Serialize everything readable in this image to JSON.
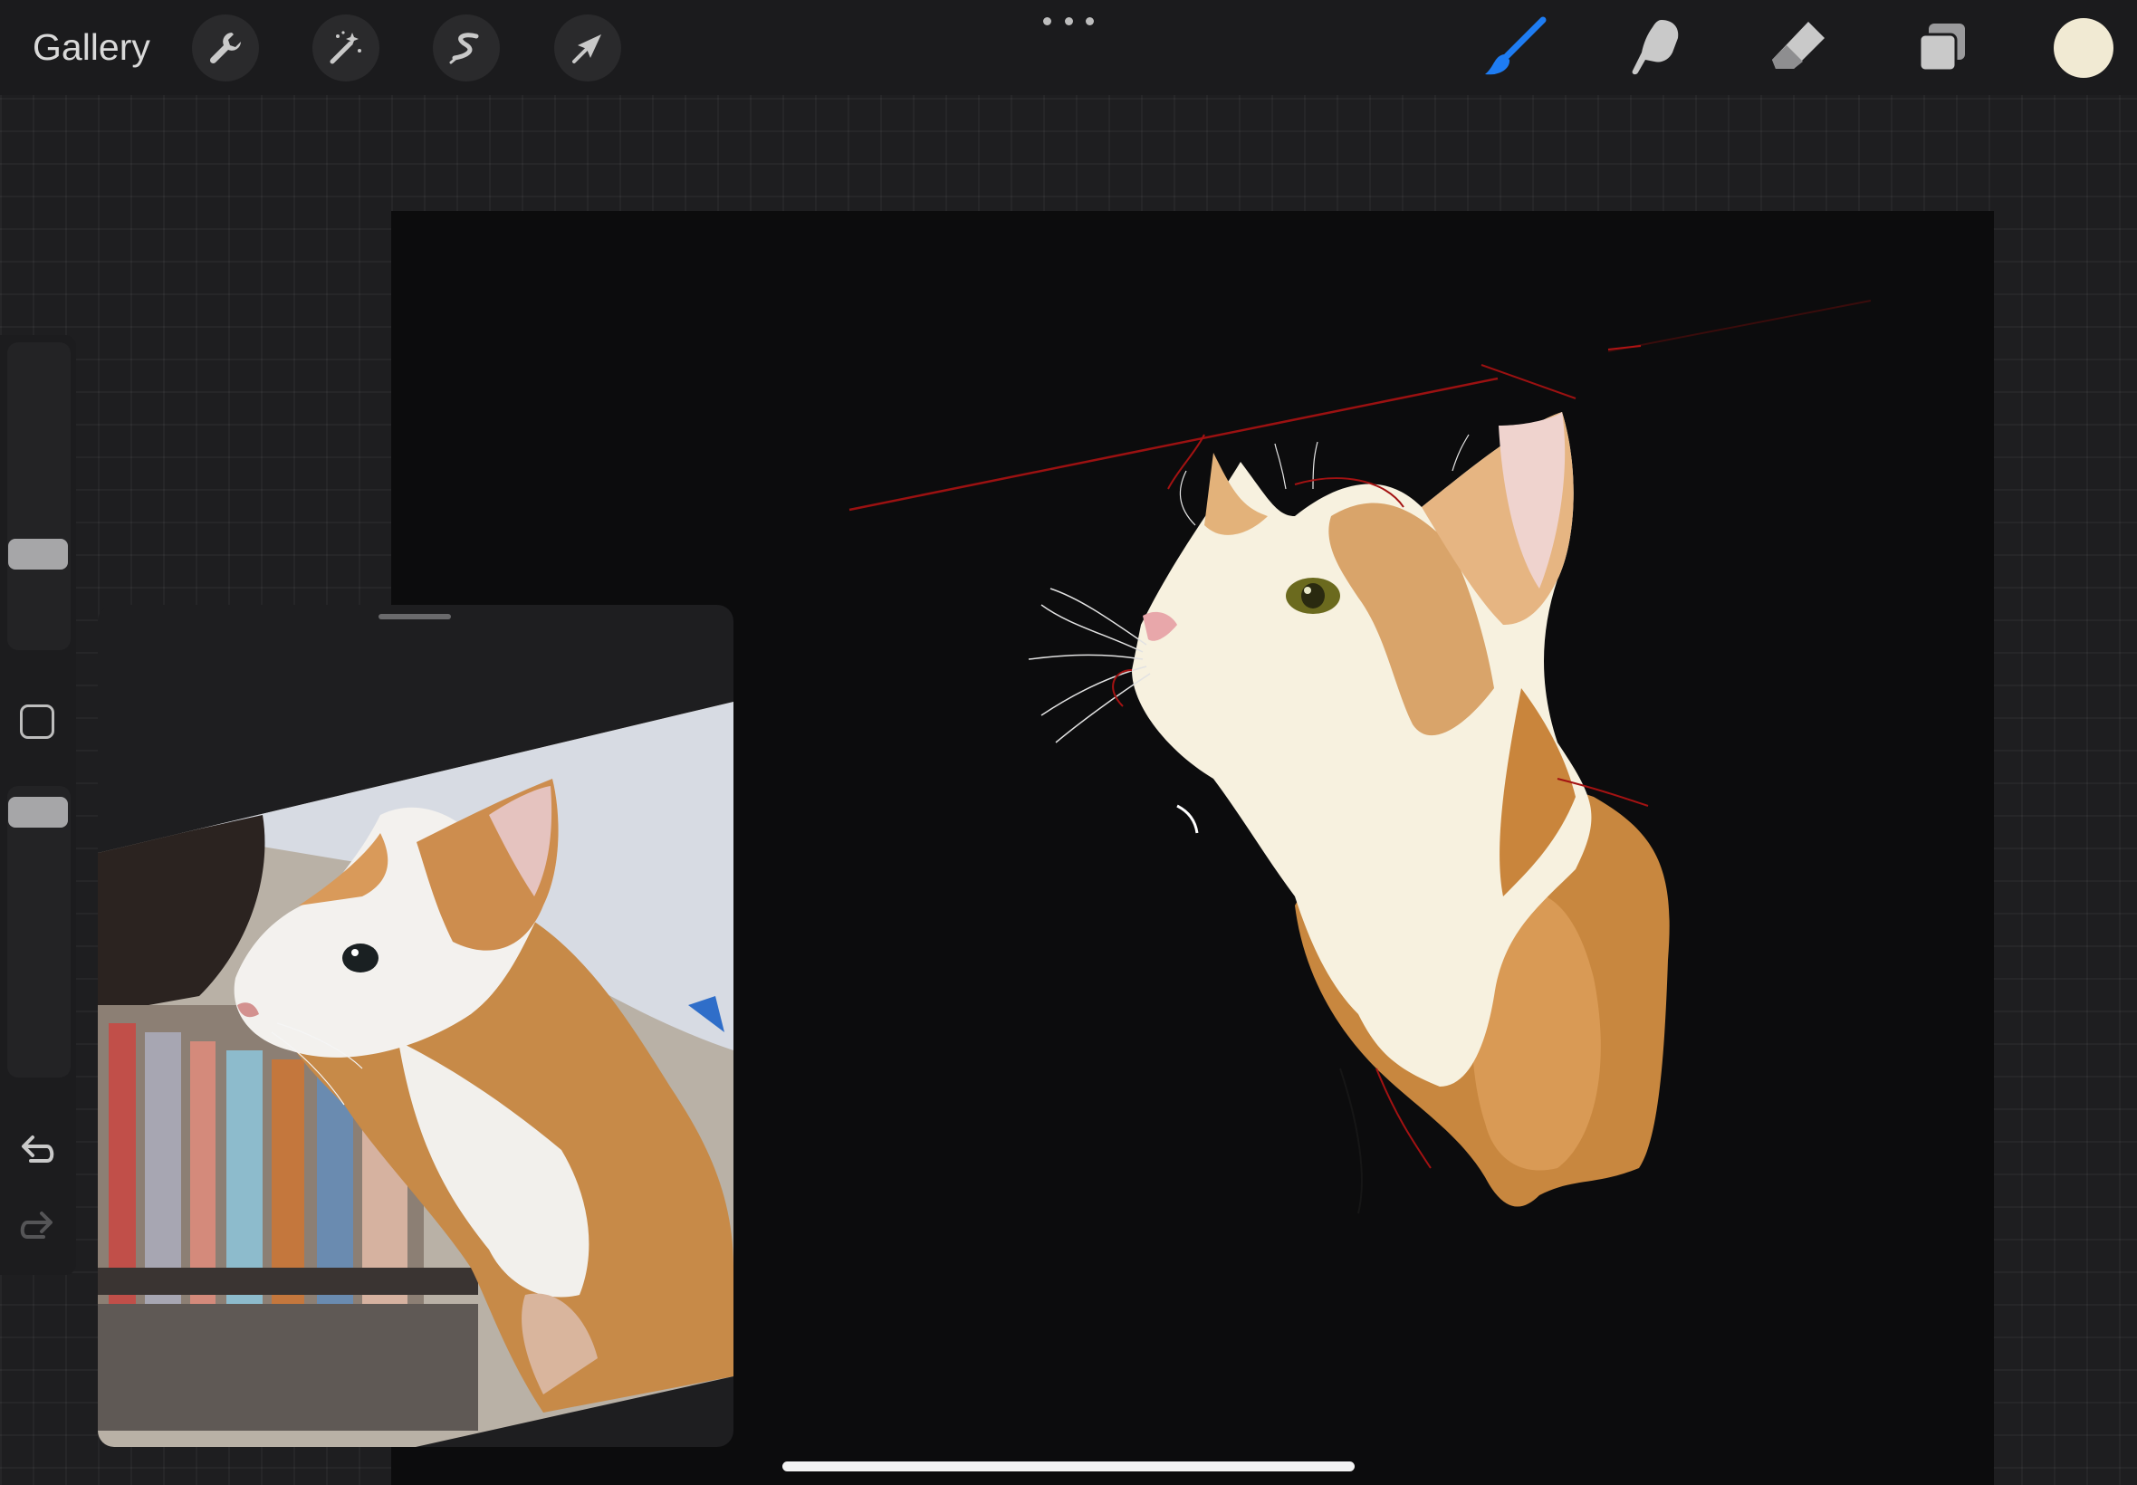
{
  "topbar": {
    "gallery_label": "Gallery",
    "left_tools": [
      {
        "name": "actions",
        "icon": "wrench-icon"
      },
      {
        "name": "adjustments",
        "icon": "magic-wand-icon"
      },
      {
        "name": "selection",
        "icon": "selection-s-icon"
      },
      {
        "name": "transform",
        "icon": "arrow-cursor-icon"
      }
    ],
    "center": {
      "icon": "more-dots-icon"
    },
    "right_tools": [
      {
        "name": "brush",
        "icon": "brush-icon",
        "active": true,
        "color": "#1e7cf2"
      },
      {
        "name": "smudge",
        "icon": "smudge-finger-icon",
        "active": false
      },
      {
        "name": "eraser",
        "icon": "eraser-icon",
        "active": false
      },
      {
        "name": "layers",
        "icon": "layers-icon",
        "active": false
      }
    ],
    "current_color": "#f1ead3"
  },
  "sidebar": {
    "brush_size_level": 0.29,
    "opacity_level": 0.96,
    "modify_button_icon": "square-icon",
    "undo_icon": "undo-arrow-icon",
    "redo_icon": "redo-arrow-icon"
  },
  "canvas": {
    "background": "#0c0c0d",
    "artwork": "cat-painting"
  },
  "reference_window": {
    "content": "cat-photo",
    "handle_icon": "drag-handle-icon"
  },
  "colors": {
    "accent": "#1e7cf2",
    "ui_dark": "#1b1b1d",
    "icon": "#c9c9c9"
  }
}
